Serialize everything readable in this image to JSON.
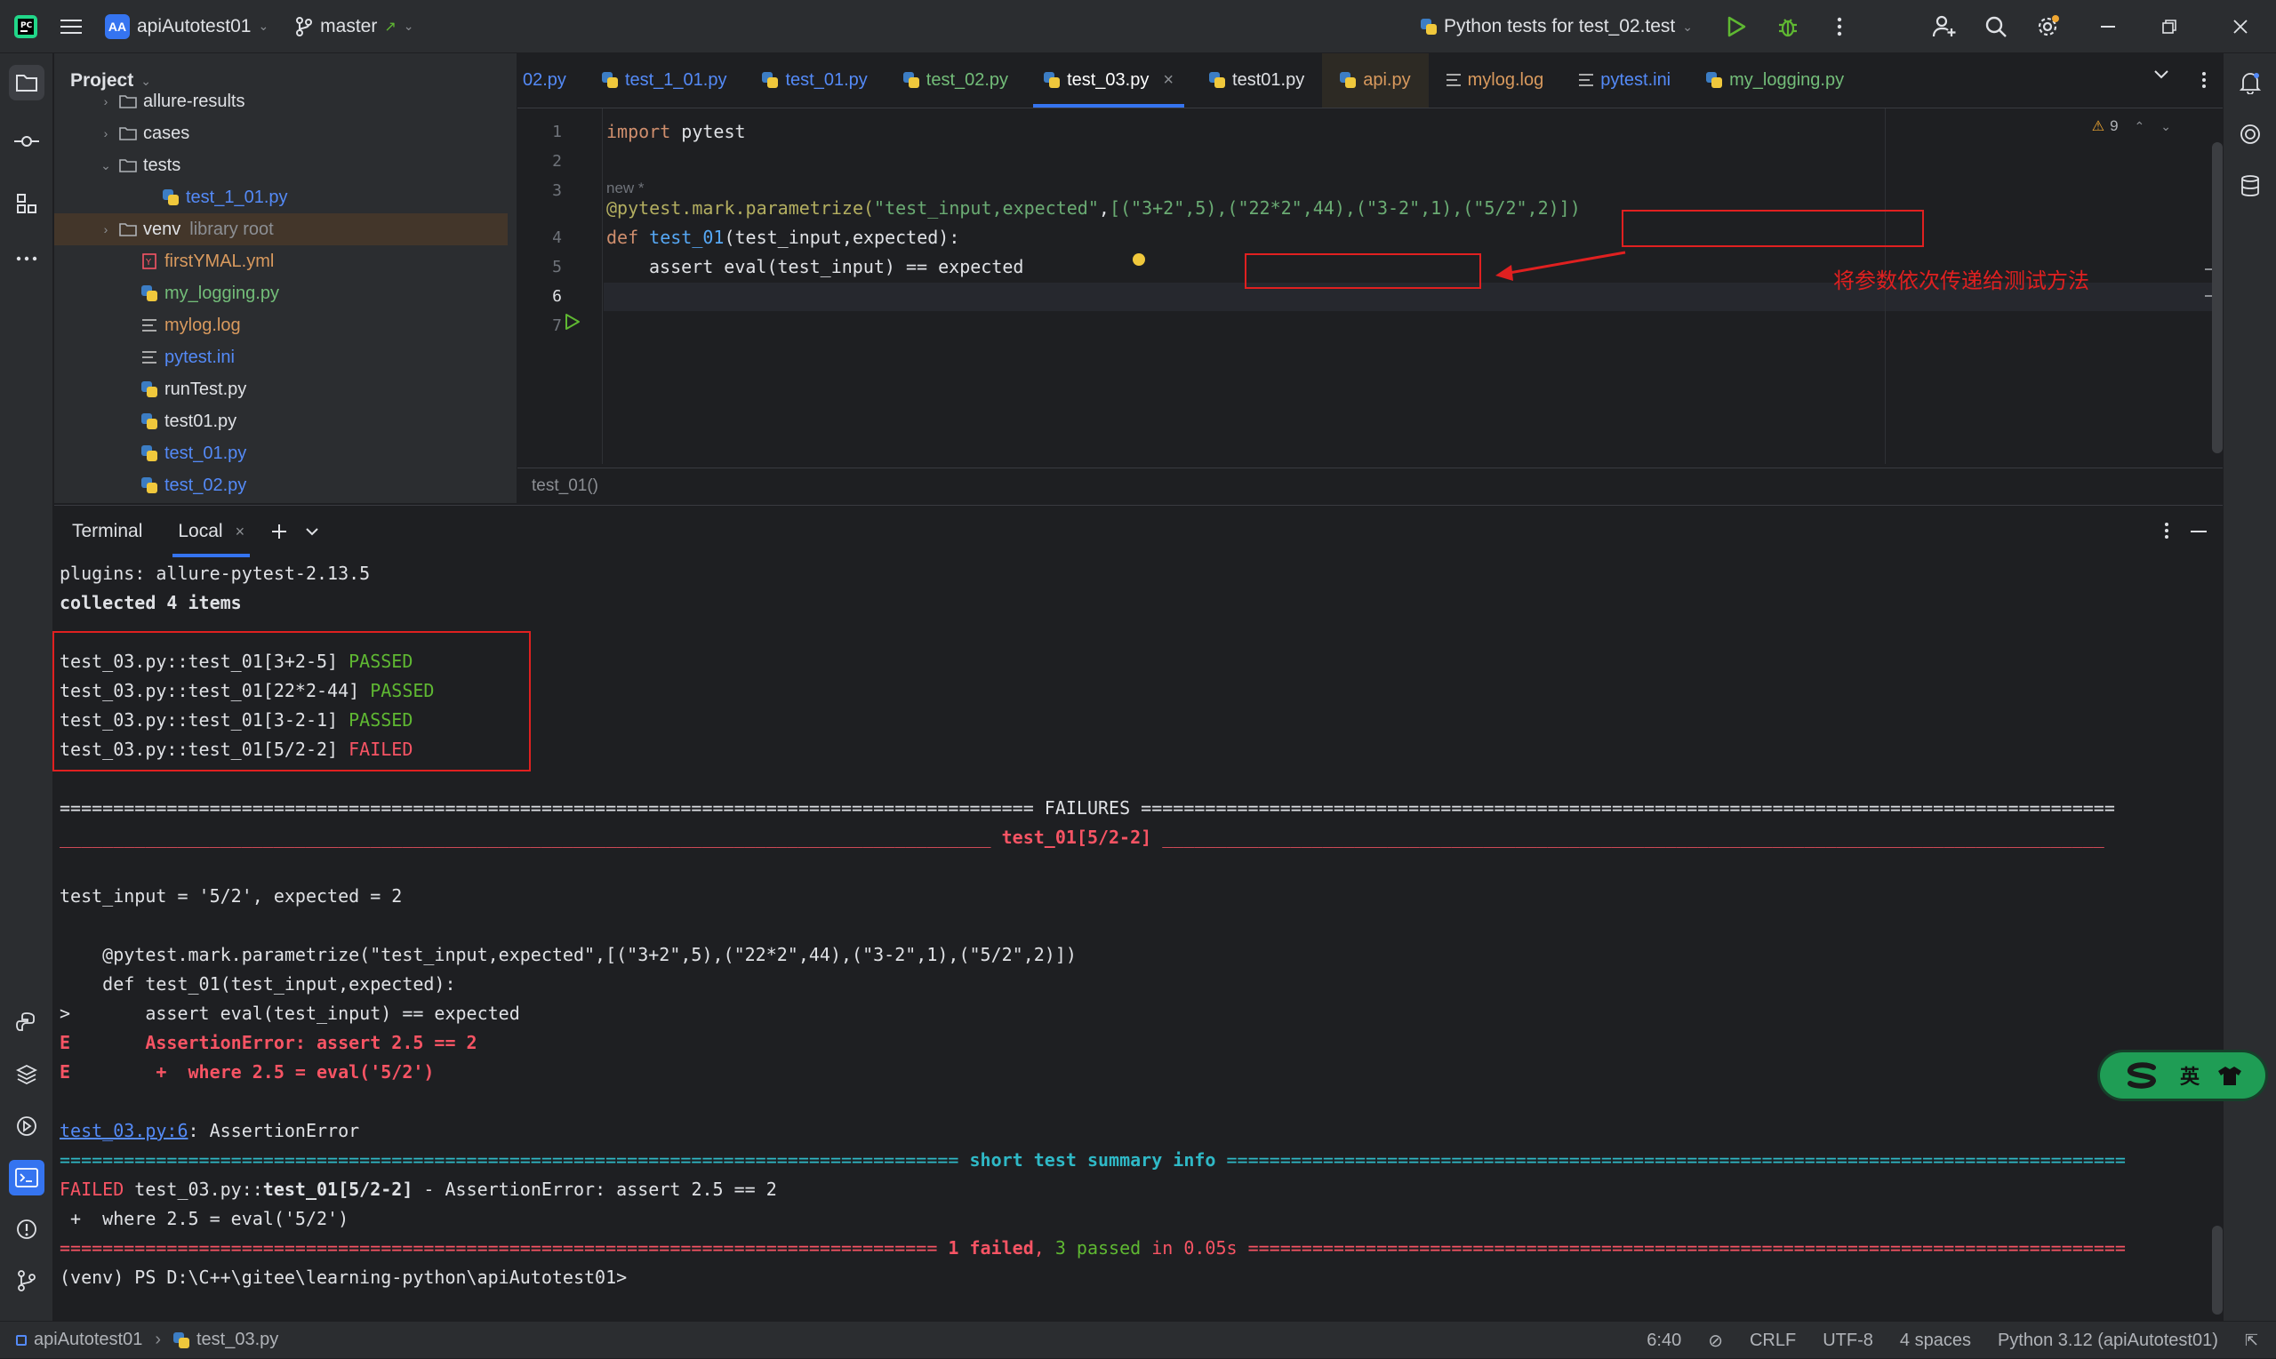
{
  "topbar": {
    "project_badge": "AA",
    "project_name": "apiAutotest01",
    "branch": "master",
    "run_config": "Python tests for test_02.test"
  },
  "project_panel": {
    "title": "Project",
    "tree": [
      {
        "label": "allure-results",
        "indent": 1,
        "chevron": "›",
        "type": "folder",
        "color": "default"
      },
      {
        "label": "cases",
        "indent": 1,
        "chevron": "›",
        "type": "folder",
        "color": "default"
      },
      {
        "label": "tests",
        "indent": 1,
        "chevron": "⌄",
        "type": "folder",
        "color": "default"
      },
      {
        "label": "test_1_01.py",
        "indent": 3,
        "chevron": "",
        "type": "py",
        "color": "blue"
      },
      {
        "label": "venv",
        "suffix": "library root",
        "indent": 1,
        "chevron": "›",
        "type": "folder",
        "color": "default",
        "selected": true
      },
      {
        "label": "firstYMAL.yml",
        "indent": 2,
        "chevron": "",
        "type": "yml",
        "color": "orange"
      },
      {
        "label": "my_logging.py",
        "indent": 2,
        "chevron": "",
        "type": "py",
        "color": "green"
      },
      {
        "label": "mylog.log",
        "indent": 2,
        "chevron": "",
        "type": "log",
        "color": "orange"
      },
      {
        "label": "pytest.ini",
        "indent": 2,
        "chevron": "",
        "type": "ini",
        "color": "blue"
      },
      {
        "label": "runTest.py",
        "indent": 2,
        "chevron": "",
        "type": "py",
        "color": "default"
      },
      {
        "label": "test01.py",
        "indent": 2,
        "chevron": "",
        "type": "py",
        "color": "default"
      },
      {
        "label": "test_01.py",
        "indent": 2,
        "chevron": "",
        "type": "py",
        "color": "blue"
      },
      {
        "label": "test_02.py",
        "indent": 2,
        "chevron": "",
        "type": "py",
        "color": "blue"
      }
    ]
  },
  "editor": {
    "tabs": [
      {
        "label": "02.py",
        "icon": "none",
        "color": "blue"
      },
      {
        "label": "test_1_01.py",
        "icon": "py",
        "color": "blue"
      },
      {
        "label": "test_01.py",
        "icon": "py",
        "color": "blue"
      },
      {
        "label": "test_02.py",
        "icon": "py",
        "color": "green"
      },
      {
        "label": "test_03.py",
        "icon": "py",
        "color": "green",
        "active": true,
        "closable": true
      },
      {
        "label": "test01.py",
        "icon": "py",
        "color": "default"
      },
      {
        "label": "api.py",
        "icon": "py",
        "color": "orange",
        "highlight": true
      },
      {
        "label": "mylog.log",
        "icon": "log",
        "color": "orange"
      },
      {
        "label": "pytest.ini",
        "icon": "log",
        "color": "blue"
      },
      {
        "label": "my_logging.py",
        "icon": "py",
        "color": "green"
      }
    ],
    "close_glyph": "×",
    "warning_count": "9",
    "line_numbers": [
      "1",
      "2",
      "3",
      "4",
      "5",
      "6",
      "7"
    ],
    "hint_new": "new *",
    "code": {
      "l1_kw": "import",
      "l1_rest": " pytest",
      "l4_dec": "@pytest.mark.parametrize(",
      "l4_str": "\"test_input,expected\"",
      "l4_list": "[(\"3+2\",5),(\"22*2\",44),(\"3-2\",1),(\"5/2\",2)])",
      "l5_kw": "def",
      "l5_fn": "test_01",
      "l5_params": "(test_input,expected):",
      "l6": "assert eval(test_input) == expected"
    },
    "annotation": "将参数依次传递给测试方法",
    "breadcrumb": "test_01()"
  },
  "terminal": {
    "title": "Terminal",
    "tab_local": "Local",
    "lines": {
      "plugins": "plugins: allure-pytest-2.13.5",
      "collected": "collected 4 items",
      "r1": "test_03.py::test_01[3+2-5]",
      "r2": "test_03.py::test_01[22*2-44]",
      "r3": "test_03.py::test_01[3-2-1]",
      "r4": "test_03.py::test_01[5/2-2]",
      "passed": "PASSED",
      "failed": "FAILED",
      "failures_left": "=========================================================================================== ",
      "failures_word": "FAILURES",
      "failures_right": " ===========================================================================================",
      "fail_sep_left": "_______________________________________________________________________________________ ",
      "fail_sep_title": "test_01[5/2-2]",
      "fail_sep_right": " ________________________________________________________________________________________",
      "vars": "test_input = '5/2', expected = 2",
      "src1": "    @pytest.mark.parametrize(\"test_input,expected\",[(\"3+2\",5),(\"22*2\",44),(\"3-2\",1),(\"5/2\",2)])",
      "src2": "    def test_01(test_input,expected):",
      "src3": ">       assert eval(test_input) == expected",
      "err1": "E       AssertionError: assert 2.5 == 2",
      "err2": "E        +  where 2.5 = eval('5/2')",
      "loc_link": "test_03.py:6",
      "loc_rest": ": AssertionError",
      "summary_left": "==================================================================================== ",
      "summary_title": "short test summary info",
      "summary_right": " ====================================================================================",
      "sum_failed": "FAILED",
      "sum_mid": " test_03.py::",
      "sum_bold": "test_01[5/2-2]",
      "sum_rest": " - AssertionError: assert 2.5 == 2",
      "sum_where": " +  where 2.5 = eval('5/2')",
      "final_left": "================================================================================== ",
      "final_failed": "1 failed",
      "final_comma": ", ",
      "final_passed": "3 passed",
      "final_time": " in 0.05s",
      "final_right": " ==================================================================================",
      "prompt": "(venv) PS D:\\C++\\gitee\\learning-python\\apiAutotest01>"
    }
  },
  "statusbar": {
    "crumb_project": "apiAutotest01",
    "crumb_file": "test_03.py",
    "position": "6:40",
    "line_sep": "CRLF",
    "encoding": "UTF-8",
    "indent": "4 spaces",
    "interpreter": "Python 3.12 (apiAutotest01)"
  },
  "ime": {
    "label": "英"
  },
  "colors": {
    "accent": "#3574f0",
    "passed": "#5fb832",
    "failed": "#f75464",
    "annotation": "#e02020"
  }
}
